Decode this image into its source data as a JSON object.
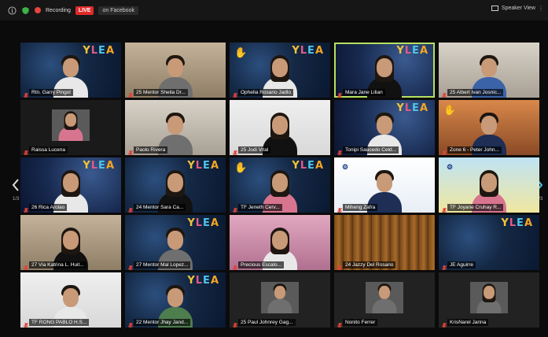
{
  "topbar": {
    "recording_label": "Recording",
    "live_label": "LIVE",
    "facebook_label": "on Facebook",
    "view_label": "Speaker View"
  },
  "nav": {
    "left_page": "1/3",
    "right_page": "1/3"
  },
  "colors": {
    "active_border": "#b7e060",
    "live_red": "#e02a2a",
    "record_red": "#e8453c"
  },
  "tiles": [
    {
      "name": "Rtn. Garry Pingol",
      "bg": "bg-tech",
      "ylea": true,
      "body": "white",
      "hair": "short",
      "muted": true
    },
    {
      "name": "25 Mentor Sheila Dr...",
      "bg": "bg-room",
      "ylea": false,
      "body": "gray",
      "hair": "short",
      "muted": true
    },
    {
      "name": "Ophelia Rosario Jadlo",
      "bg": "bg-tech",
      "ylea": true,
      "hand": true,
      "body": "white",
      "hair": "long",
      "muted": true
    },
    {
      "name": "Mara Jane Lilian",
      "bg": "bg-tech-b",
      "ylea": true,
      "body": "black",
      "hair": "long",
      "muted": false,
      "active": true
    },
    {
      "name": "25 Albert Ivan Josnic...",
      "bg": "bg-room2",
      "ylea": false,
      "body": "blue",
      "hair": "short",
      "muted": true
    },
    {
      "name": "Raissa Lucena",
      "bg": "bg-dark",
      "ylea": false,
      "body": "pink",
      "hair": "long",
      "muted": true,
      "thumb": true
    },
    {
      "name": "Paolo Rivera",
      "bg": "bg-room2",
      "ylea": false,
      "body": "gray",
      "hair": "short",
      "muted": true
    },
    {
      "name": "25 Jodi Vital",
      "bg": "bg-white",
      "ylea": false,
      "body": "black",
      "hair": "long",
      "muted": true
    },
    {
      "name": "Tonipi Saucedo Celd...",
      "bg": "bg-tech-b",
      "ylea": true,
      "body": "white",
      "hair": "short",
      "muted": true
    },
    {
      "name": "Zone 6 - Peter John...",
      "bg": "bg-orange",
      "ylea": false,
      "hand": true,
      "body": "navy",
      "hair": "short",
      "muted": true
    },
    {
      "name": "26 Rica Arolao",
      "bg": "bg-tech-b",
      "ylea": true,
      "body": "white",
      "hair": "long",
      "muted": true
    },
    {
      "name": "24 Mentor Sara Ca...",
      "bg": "bg-tech",
      "ylea": true,
      "body": "black",
      "hair": "long",
      "muted": true
    },
    {
      "name": "TF Jeneth Cerv...",
      "bg": "bg-tech",
      "ylea": true,
      "hand": true,
      "body": "pink",
      "hair": "long",
      "muted": true
    },
    {
      "name": "Miheng Zafra",
      "bg": "bg-rotary",
      "ylea": false,
      "rotary": true,
      "body": "navy",
      "hair": "short",
      "muted": true
    },
    {
      "name": "TF Joyane Cruhay R...",
      "bg": "bg-rotary2",
      "ylea": false,
      "rotary": true,
      "body": "pink",
      "hair": "long",
      "muted": true
    },
    {
      "name": "27 Via Katrina L. Huit...",
      "bg": "bg-room",
      "ylea": false,
      "body": "black",
      "hair": "long",
      "muted": true
    },
    {
      "name": "27 Mentor Mal Lopez...",
      "bg": "bg-tech",
      "ylea": true,
      "body": "gray",
      "hair": "short",
      "muted": true
    },
    {
      "name": "Precious Escalo...",
      "bg": "bg-pink",
      "ylea": false,
      "body": "white",
      "hair": "long",
      "muted": true
    },
    {
      "name": "24 Jazzy Del Rosario",
      "bg": "bg-curtain",
      "ylea": false,
      "body": "black",
      "hair": "short",
      "muted": true,
      "nobody": true
    },
    {
      "name": "JE Aguirre",
      "bg": "bg-tech",
      "ylea": true,
      "body": "navy",
      "hair": "short",
      "muted": true,
      "nobody": true
    },
    {
      "name": "TF RONG PABLO H.S...",
      "bg": "bg-white",
      "ylea": false,
      "body": "white",
      "hair": "short",
      "muted": true
    },
    {
      "name": "22 Mentor Jhay Jand...",
      "bg": "bg-tech",
      "ylea": true,
      "body": "green",
      "hair": "short",
      "muted": true
    },
    {
      "name": "25 Paul Johnrey Gag...",
      "bg": "bg-blank",
      "ylea": false,
      "body": "gray",
      "hair": "short",
      "muted": true,
      "thumb": true
    },
    {
      "name": "Nonito Ferrer",
      "bg": "bg-blank",
      "ylea": false,
      "body": "gray",
      "hair": "short",
      "muted": true,
      "thumb": true
    },
    {
      "name": "KrisNarel Jarina",
      "bg": "bg-blank",
      "ylea": false,
      "body": "gray",
      "hair": "long",
      "muted": true,
      "thumb": true
    }
  ]
}
